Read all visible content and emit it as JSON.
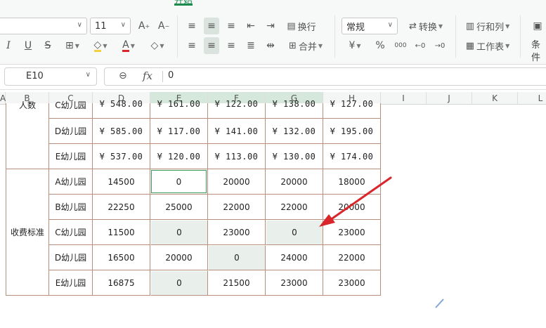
{
  "ribbon": {
    "tabs": [
      {
        "label": "开始",
        "active": true
      }
    ],
    "font_name": "",
    "font_size": "11",
    "wrap_text_label": "换行",
    "merge_label": "合并",
    "number_format": "常规",
    "convert_label": "转换",
    "row_col_label": "行和列",
    "worksheet_label": "工作表",
    "cond_format_label": "条件",
    "percent_symbol": "%",
    "thousands_symbol": "000",
    "currency_symbol": "¥",
    "bold_label": "I",
    "underline_label": "U",
    "strike_label": "S",
    "grow_font": "A",
    "shrink_font": "A",
    "font_color_letter": "A",
    "accent_color": "#1e8b4e"
  },
  "formula_bar": {
    "cell_ref": "E10",
    "fx_label": "fx",
    "value": "0"
  },
  "columns": [
    "A",
    "B",
    "C",
    "D",
    "E",
    "F",
    "G",
    "H",
    "I",
    "J",
    "K",
    "L"
  ],
  "table": {
    "section_people_label": "人数",
    "section_fee_label": "收费标准",
    "people_rows": [
      {
        "kg": "C幼儿园",
        "D": "¥  548.00",
        "E": "¥  161.00",
        "F": "¥  122.00",
        "G": "¥  138.00",
        "H": "¥  127.00"
      },
      {
        "kg": "D幼儿园",
        "D": "¥  585.00",
        "E": "¥  117.00",
        "F": "¥  141.00",
        "G": "¥  132.00",
        "H": "¥  195.00"
      },
      {
        "kg": "E幼儿园",
        "D": "¥  537.00",
        "E": "¥  120.00",
        "F": "¥  113.00",
        "G": "¥  130.00",
        "H": "¥  174.00"
      }
    ],
    "fee_rows": [
      {
        "kg": "A幼儿园",
        "D": "14500",
        "E": "0",
        "F": "20000",
        "G": "20000",
        "H": "18000"
      },
      {
        "kg": "B幼儿园",
        "D": "22250",
        "E": "25000",
        "F": "22000",
        "G": "22000",
        "H": "20000"
      },
      {
        "kg": "C幼儿园",
        "D": "11500",
        "E": "0",
        "F": "23000",
        "G": "0",
        "H": "23000"
      },
      {
        "kg": "D幼儿园",
        "D": "16500",
        "E": "20000",
        "F": "0",
        "G": "24000",
        "H": "22000"
      },
      {
        "kg": "E幼儿园",
        "D": "16875",
        "E": "0",
        "F": "21500",
        "G": "23000",
        "H": "23000"
      }
    ]
  },
  "colors": {
    "shade": "#e9efeb",
    "grid_line": "#b88f7a",
    "selection": "#2f8d57",
    "arrow": "#d9262b"
  }
}
